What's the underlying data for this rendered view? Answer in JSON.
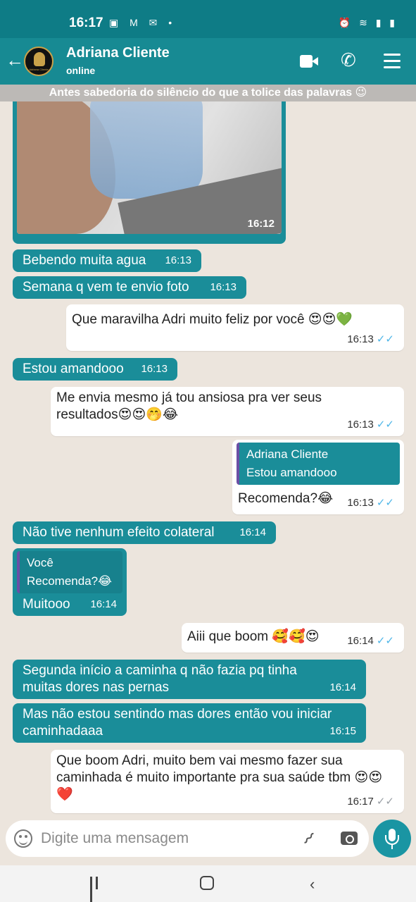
{
  "status_bar": {
    "time": "16:17",
    "left_icons": "▣ M ✉ •",
    "right_icons": "⏰ ≋ ▮ ▮"
  },
  "header": {
    "contact_name": "Adriana Cliente",
    "status": "online",
    "avatar_text": "Adriana Cliente"
  },
  "wallpaper_text": "Antes sabedoria do silêncio do que a tolice das palavras 😉",
  "messages": [
    {
      "type": "image",
      "direction": "in",
      "time": "16:12"
    },
    {
      "direction": "in",
      "text": "Bebendo muita agua",
      "time": "16:13"
    },
    {
      "direction": "in",
      "text": "Semana q vem te envio foto",
      "time": "16:13"
    },
    {
      "direction": "out",
      "text": "Que maravilha Adri muito feliz por você 😍😍💚",
      "time": "16:13",
      "tick": "✓✓"
    },
    {
      "direction": "in",
      "text": "Estou amandooo",
      "time": "16:13"
    },
    {
      "direction": "out",
      "text": "Me envia mesmo já tou ansiosa pra ver seus resultados😍😍🤭😂",
      "time": "16:13",
      "tick": "✓✓"
    },
    {
      "direction": "out",
      "quote_author": "Adriana Cliente",
      "quote_text": "Estou amandooo",
      "text": "Recomenda?😂",
      "time": "16:13",
      "tick": "✓✓"
    },
    {
      "direction": "in",
      "text": "Não tive nenhum efeito colateral",
      "time": "16:14"
    },
    {
      "direction": "in",
      "quote_author": "Você",
      "quote_text": "Recomenda?😂",
      "text": "Muitooo",
      "time": "16:14"
    },
    {
      "direction": "out",
      "text": "Aiii que boom 🥰🥰😍",
      "time": "16:14",
      "tick": "✓✓"
    },
    {
      "direction": "in",
      "text": "Segunda início a caminha q não fazia pq tinha muitas dores nas pernas",
      "time": "16:14"
    },
    {
      "direction": "in",
      "text": "Mas não estou sentindo mas dores então vou iniciar caminhadaaa",
      "time": "16:15"
    },
    {
      "direction": "out",
      "text": "Que boom Adri, muito bem vai mesmo fazer sua caminhada é muito importante pra sua saúde tbm 😍😍❤️",
      "time": "16:17",
      "tick": "✓✓"
    }
  ],
  "composer": {
    "placeholder": "Digite uma mensagem"
  },
  "colors": {
    "header": "#178a93",
    "incoming": "#1a8d99",
    "outgoing": "#ffffff",
    "background": "#ece5dd",
    "read_tick": "#4fb6e8"
  }
}
